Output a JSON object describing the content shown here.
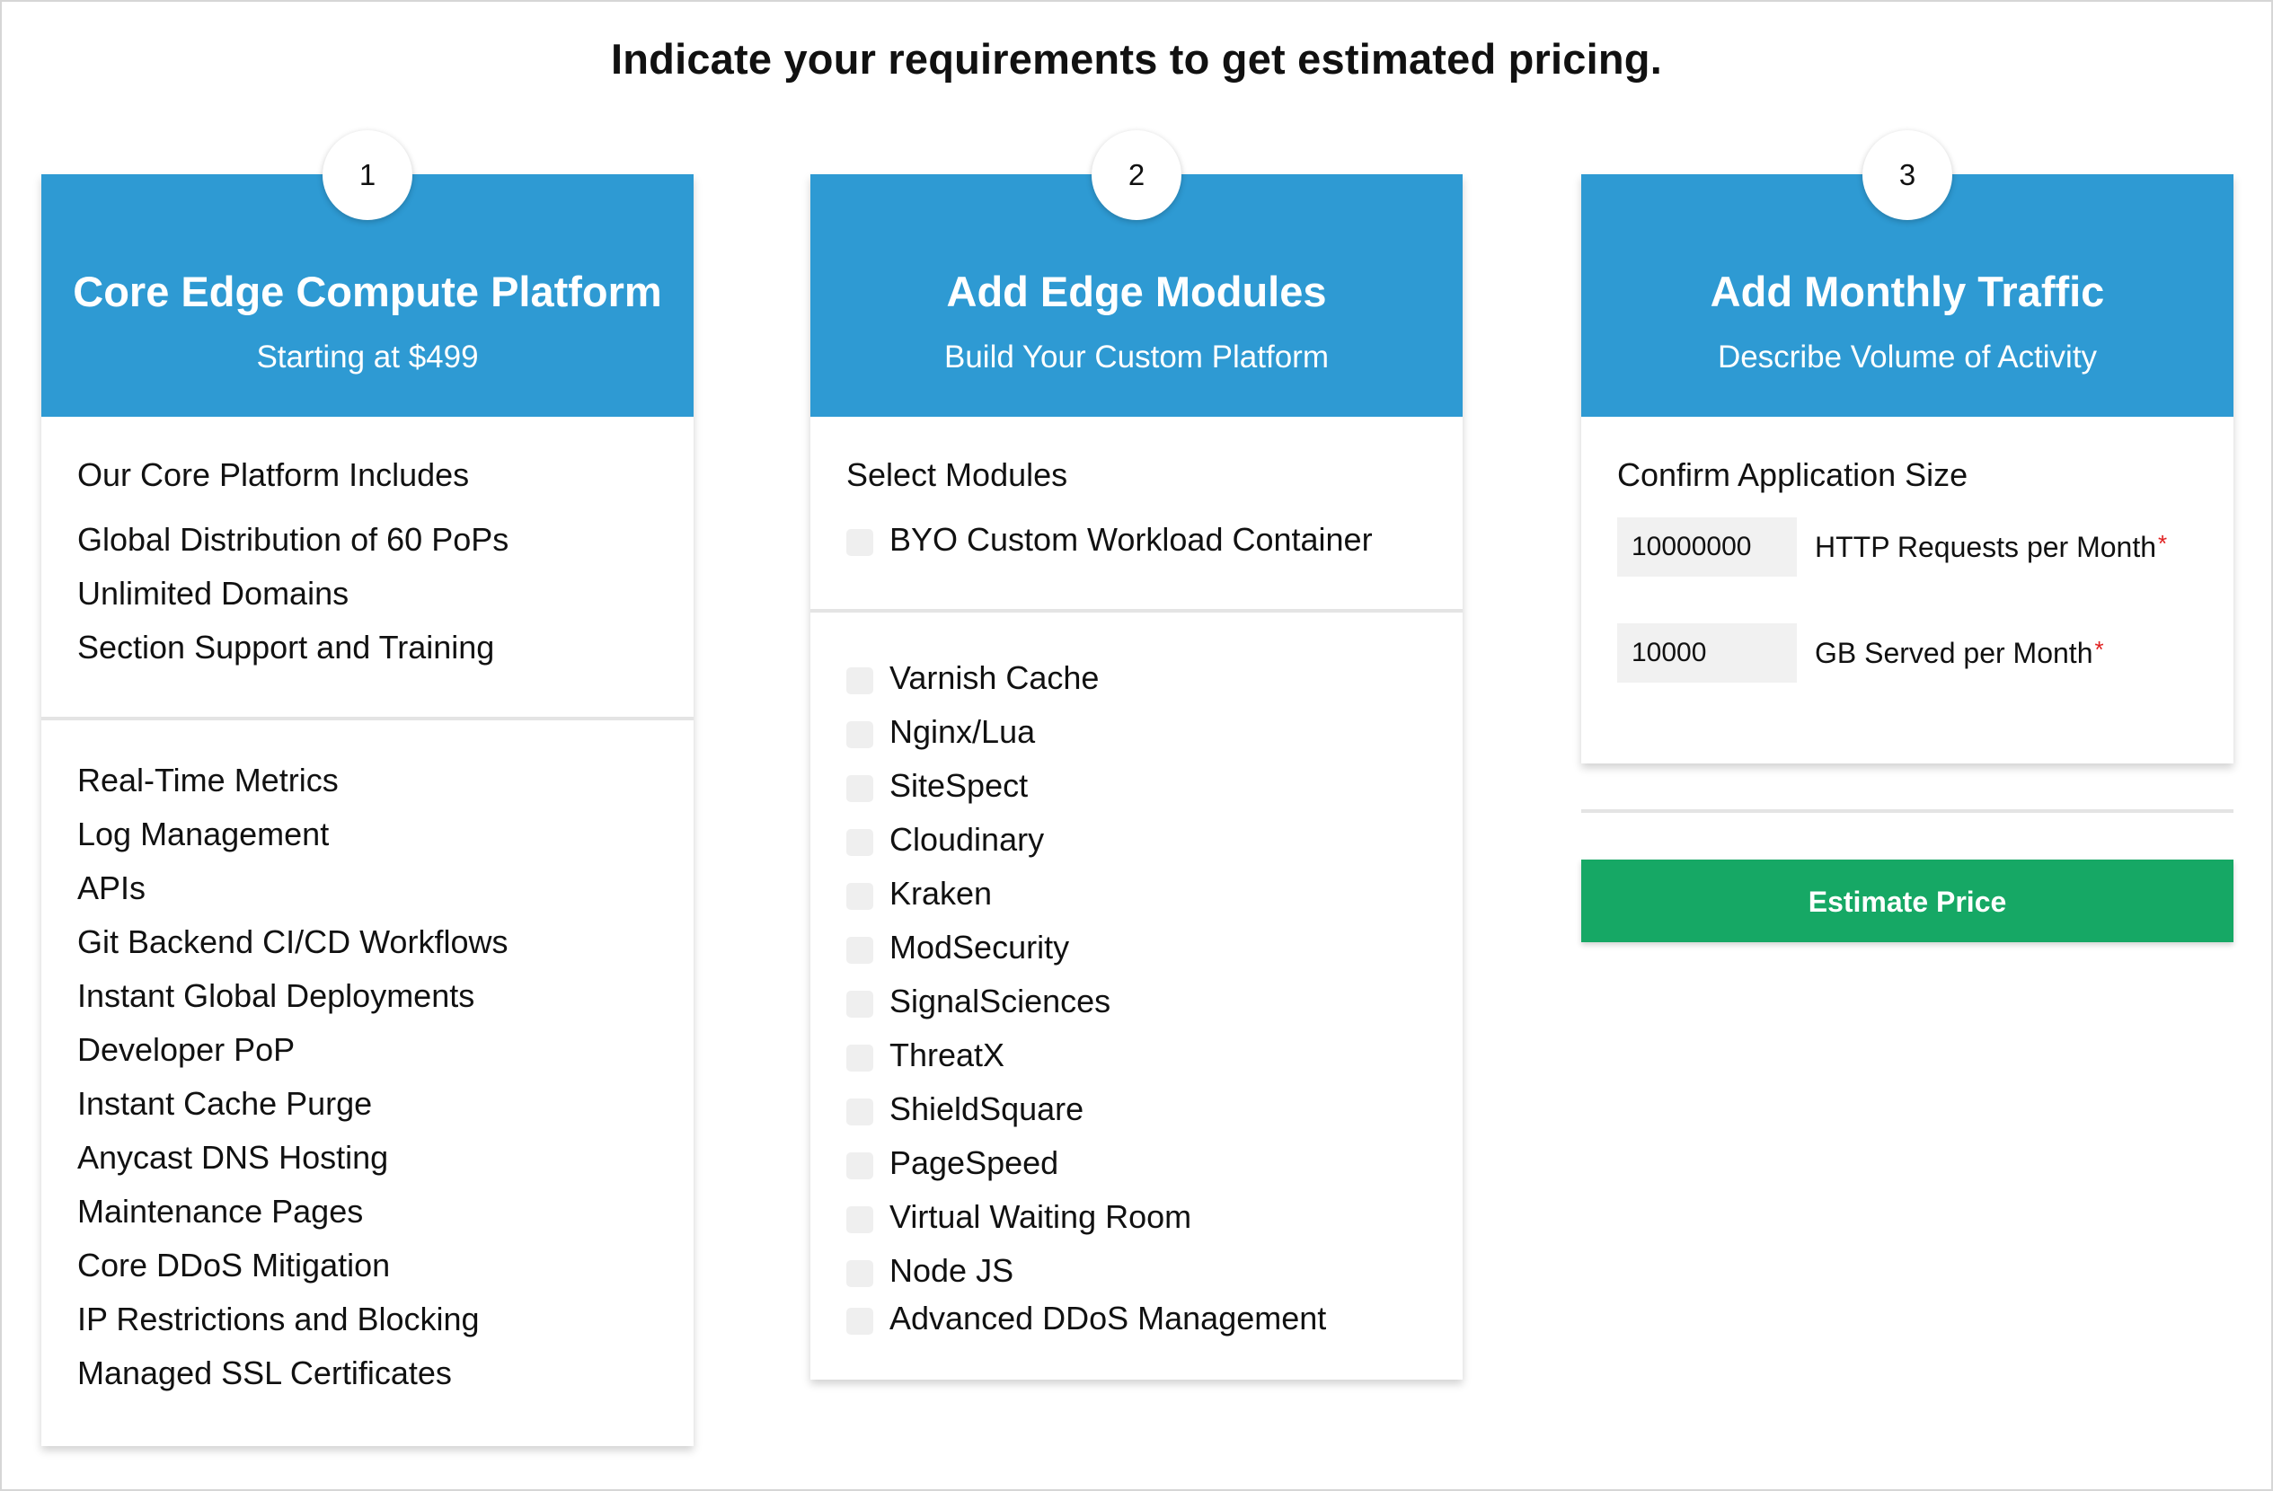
{
  "page": {
    "headline": "Indicate your requirements to get estimated pricing."
  },
  "colors": {
    "header_blue": "#2e9ad3",
    "button_green": "#16a865",
    "required_red": "#e02020"
  },
  "card1": {
    "step": "1",
    "title": "Core Edge Compute Platform",
    "subtitle": "Starting at $499",
    "section_heading": "Our Core Platform Includes",
    "includes": [
      "Global Distribution of 60 PoPs",
      "Unlimited Domains",
      "Section Support and Training"
    ],
    "features": [
      "Real-Time Metrics",
      "Log Management",
      "APIs",
      "Git Backend CI/CD Workflows",
      "Instant Global Deployments",
      "Developer PoP",
      "Instant Cache Purge",
      "Anycast DNS Hosting",
      "Maintenance Pages",
      "Core DDoS Mitigation",
      "IP Restrictions and Blocking",
      "Managed SSL Certificates"
    ]
  },
  "card2": {
    "step": "2",
    "title": "Add Edge Modules",
    "subtitle": "Build Your Custom Platform",
    "section_heading": "Select Modules",
    "top_module": "BYO Custom Workload Container",
    "modules": [
      "Varnish Cache",
      "Nginx/Lua",
      "SiteSpect",
      "Cloudinary",
      "Kraken",
      "ModSecurity",
      "SignalSciences",
      "ThreatX",
      "ShieldSquare",
      "PageSpeed",
      "Virtual Waiting Room",
      "Node JS",
      "Advanced DDoS Management"
    ]
  },
  "card3": {
    "step": "3",
    "title": "Add Monthly Traffic",
    "subtitle": "Describe Volume of Activity",
    "section_heading": "Confirm Application Size",
    "requests": {
      "value": "10000000",
      "label": "HTTP Requests per Month",
      "required_mark": "*"
    },
    "gb_served": {
      "value": "10000",
      "label": "GB Served per Month",
      "required_mark": "*"
    }
  },
  "actions": {
    "estimate_label": "Estimate Price"
  }
}
